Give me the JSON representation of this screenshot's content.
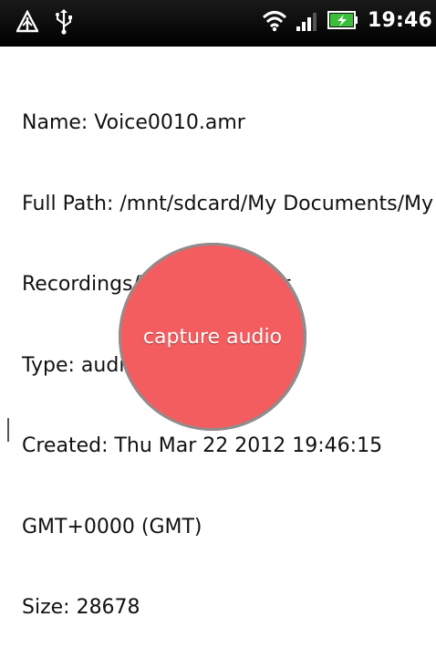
{
  "status_bar": {
    "time": "19:46",
    "icons": [
      "alert-triangle-icon",
      "usb-icon",
      "wifi-icon",
      "signal-icon",
      "battery-charging-icon"
    ]
  },
  "file_info": {
    "lines": [
      "Name: Voice0010.amr",
      "Full Path: /mnt/sdcard/My Documents/My",
      "Recordings/Voice0010.amr",
      "Type: audio/amr",
      "Created: Thu Mar 22 2012 19:46:15",
      "GMT+0000 (GMT)",
      "Size: 28678"
    ]
  },
  "capture_button": {
    "label": "capture audio",
    "color": "#f45d5f"
  }
}
